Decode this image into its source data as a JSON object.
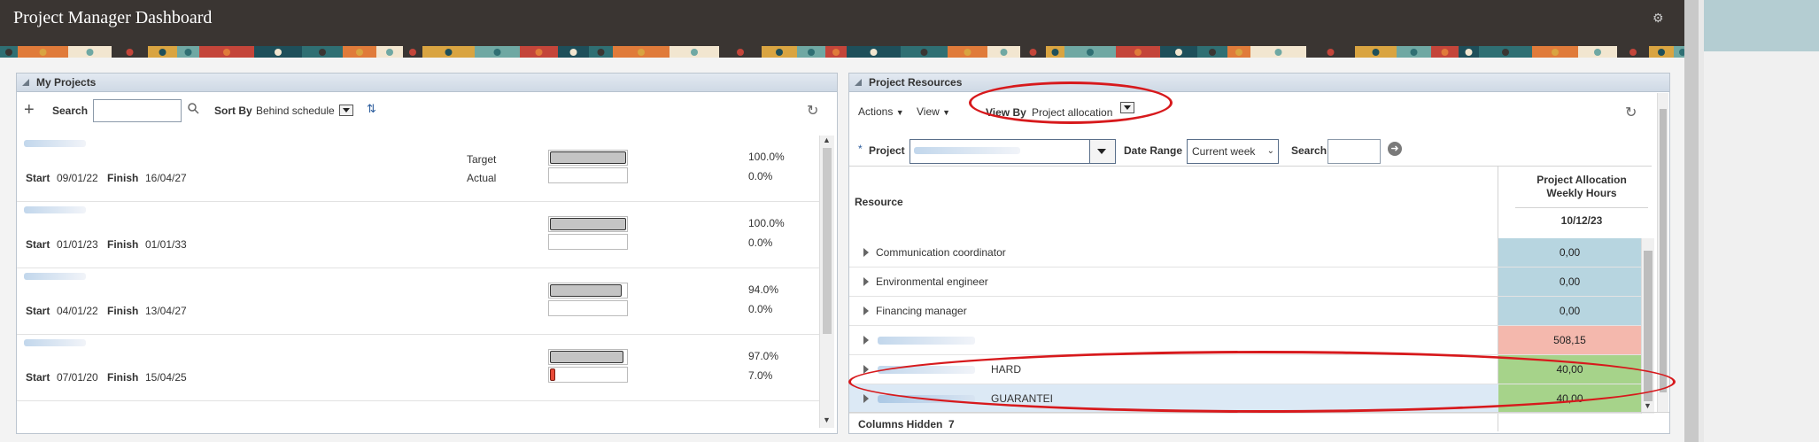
{
  "app": {
    "title": "Project Manager Dashboard"
  },
  "my_projects": {
    "title": "My Projects",
    "toolbar": {
      "search_label": "Search",
      "sort_label": "Sort By",
      "sort_value": "Behind schedule"
    },
    "projects": [
      {
        "start_label": "Start",
        "start": "09/01/22",
        "finish_label": "Finish",
        "finish": "16/04/27",
        "target_label": "Target",
        "actual_label": "Actual",
        "target_pct": "100.0%",
        "actual_pct": "0.0%",
        "target": 1.0,
        "actual": 0.0
      },
      {
        "start_label": "Start",
        "start": "01/01/23",
        "finish_label": "Finish",
        "finish": "01/01/33",
        "target_pct": "100.0%",
        "actual_pct": "0.0%",
        "target": 1.0,
        "actual": 0.0
      },
      {
        "start_label": "Start",
        "start": "04/01/22",
        "finish_label": "Finish",
        "finish": "13/04/27",
        "target_pct": "94.0%",
        "actual_pct": "0.0%",
        "target": 0.94,
        "actual": 0.0
      },
      {
        "start_label": "Start",
        "start": "07/01/20",
        "finish_label": "Finish",
        "finish": "15/04/25",
        "target_pct": "97.0%",
        "actual_pct": "7.0%",
        "target": 0.97,
        "actual": 0.07
      }
    ]
  },
  "resources": {
    "title": "Project Resources",
    "toolbar": {
      "actions_label": "Actions",
      "view_label": "View",
      "view_by_label": "View By",
      "view_by_value": "Project allocation"
    },
    "filters": {
      "project_label": "Project",
      "date_range_label": "Date Range",
      "date_range_value": "Current week",
      "search_label": "Search"
    },
    "table": {
      "resource_header": "Resource",
      "allocation_header_line1": "Project Allocation",
      "allocation_header_line2": "Weekly Hours",
      "date_header": "10/12/23",
      "rows": [
        {
          "name": "Communication coordinator",
          "value": "0,00",
          "status": "normal"
        },
        {
          "name": "Environmental engineer",
          "value": "0,00",
          "status": "normal"
        },
        {
          "name": "Financing manager",
          "value": "0,00",
          "status": "normal"
        },
        {
          "name": "",
          "value": "508,15",
          "status": "over"
        },
        {
          "name": "HARD",
          "value": "40,00",
          "status": "ok"
        },
        {
          "name": "GUARANTEI",
          "value": "40,00",
          "status": "ok"
        }
      ]
    },
    "columns_hidden_label": "Columns Hidden",
    "columns_hidden_count": "7"
  },
  "colors": {
    "normal": "#b7d5e0",
    "over": "#f4b8ad",
    "ok": "#a6d38a",
    "annotation": "#d7191c",
    "header": "#3a3532"
  },
  "icons": [
    "settings-gear-icon",
    "add-icon",
    "search-icon",
    "sort-order-icon",
    "refresh-icon",
    "dropdown-icon",
    "go-arrow-icon"
  ]
}
